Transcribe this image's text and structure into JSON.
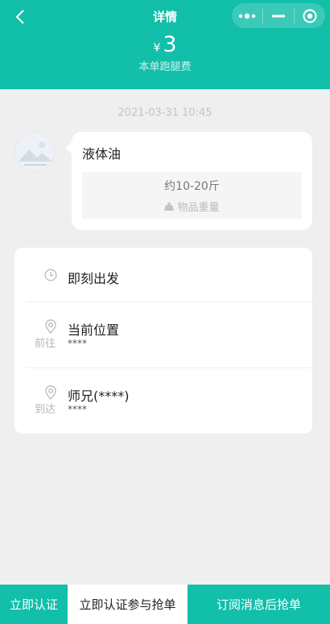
{
  "nav": {
    "title": "详情"
  },
  "fee": {
    "currency": "¥",
    "amount": "3",
    "label": "本单跑腿费"
  },
  "message": {
    "timestamp": "2021-03-31 10:45",
    "goods_name": "液体油",
    "weight_value": "约10-20斤",
    "weight_label": "物品重量"
  },
  "route": {
    "depart_label": "即刻出发",
    "from_tag": "前往",
    "from_title": "当前位置",
    "from_detail": "****",
    "to_tag": "到达",
    "to_title": "师兄(****)",
    "to_detail": "****"
  },
  "bottom_bar": {
    "certify_label": "立即认证",
    "certify_grab_label": "立即认证参与抢单",
    "subscribe_grab_label": "订阅消息后抢单"
  },
  "colors": {
    "brand": "#12bfa9",
    "page_bg": "#efefef"
  }
}
